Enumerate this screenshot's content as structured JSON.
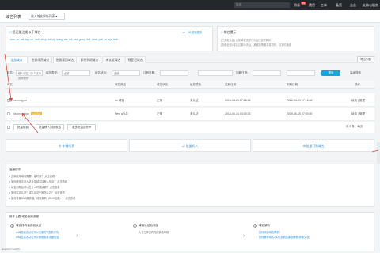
{
  "topbar": {
    "search_placeholder": "搜索",
    "links": [
      "消息",
      "费用",
      "工单",
      "备案",
      "企业",
      "支持与服务"
    ],
    "message_badge": "99"
  },
  "subbar": {
    "title": "域名列表",
    "filter_button": "进入域名解析列表 ▾"
  },
  "promo": {
    "title": "您还能注册以下域名",
    "extras": ".cn ~ 35  查看更多",
    "suffixes": ".com .cn .net .top .xin .club .shop .ltd .vip .wang .site .ink .red .group .link .work .pub .cc .xyz .tech"
  },
  "notice": {
    "title": "域名提示",
    "line1": "[已实名认证] 出现域名违规行为后已暂停解析",
    "line2": "[查看全部] 域名过期30天后，其链接等服务将暂停，请及时续费",
    "btn": "隐私保护"
  },
  "tabs": [
    "全部域名",
    "急需续费域名",
    "急需赎回域名",
    "即将到期域名",
    "未认证域名",
    "预登记域名"
  ],
  "tab_action": "导出列表",
  "filters": {
    "domain_label": "域名：",
    "domain_placeholder": "输入域名（多个请用逗号隔开）",
    "type_label": "域名类型：",
    "type_value": "全部",
    "status_label": "域名状态：",
    "status_value": "全部",
    "reg_label": "注册日期：",
    "exp_label": "到期日期：",
    "search_btn": "搜索",
    "advanced_btn": "高级搜索"
  },
  "table": {
    "headers": [
      "域名",
      "域名类型",
      "域名状态",
      "信息模板",
      "注册日期",
      "到期日期",
      "操作"
    ],
    "rows": [
      {
        "domain": "xxxxxxg.cn",
        "type": "cn 域名",
        "status": "正常",
        "template": "未认证",
        "reg": "2016-04-21 17:16:46",
        "exp": "2022-04-21 17:16:46",
        "action": "续费 | 管理",
        "badge": ""
      },
      {
        "domain": "xxxxxxxx.xxx",
        "type": "New gTLD",
        "status": "正常",
        "template": "未认证",
        "reg": "2016-06-14 03:00:33",
        "exp": "2019-06-15 07:00:00",
        "action": "续费 | 管理",
        "badge": "站名待审"
      }
    ],
    "batch_renew": "批量续费",
    "batch_transfer": "批量移入到回收站",
    "more": "更多批量操作 ▾",
    "pagination": "共 2 条，每页"
  },
  "quick_links": [
    "申请续费",
    "批量转入",
    "批量订购域名"
  ],
  "tips": {
    "title": "温馨提示",
    "lines": [
      "• 正确使用域名需要一定时间？  点击查看",
      "• 如何修改注册人信息及域名持有人信息？  点击查看",
      "• 域名到期后可以在什么时候续费？  点击查看",
      "• 如何实名认证？域名认证失败怎么办？  点击查看",
      "• 如何设置DNS服务器、修改解析（DNS设置）？  点击查看"
    ]
  },
  "guide": {
    "title": "新手上路  域名使用流程",
    "steps": [
      {
        "num": "1",
        "title": "域名持有者实名认证",
        "lines": [
          "cn域名实名认证可以注册的?(查看详情)",
          "cn域名实名认证可以使用查看详细信息"
        ]
      },
      {
        "num": "2",
        "title": "域名认证后添加",
        "lines": [
          "大于工作日内完成实名审核"
        ]
      },
      {
        "num": "3",
        "title": "域名解析",
        "lines": [
          "如何添加域名解析?",
          "如何解析域名: 实时查看结果及解析(帮助文档)"
        ]
      }
    ]
  },
  "status_url": "javascript:void(0);"
}
